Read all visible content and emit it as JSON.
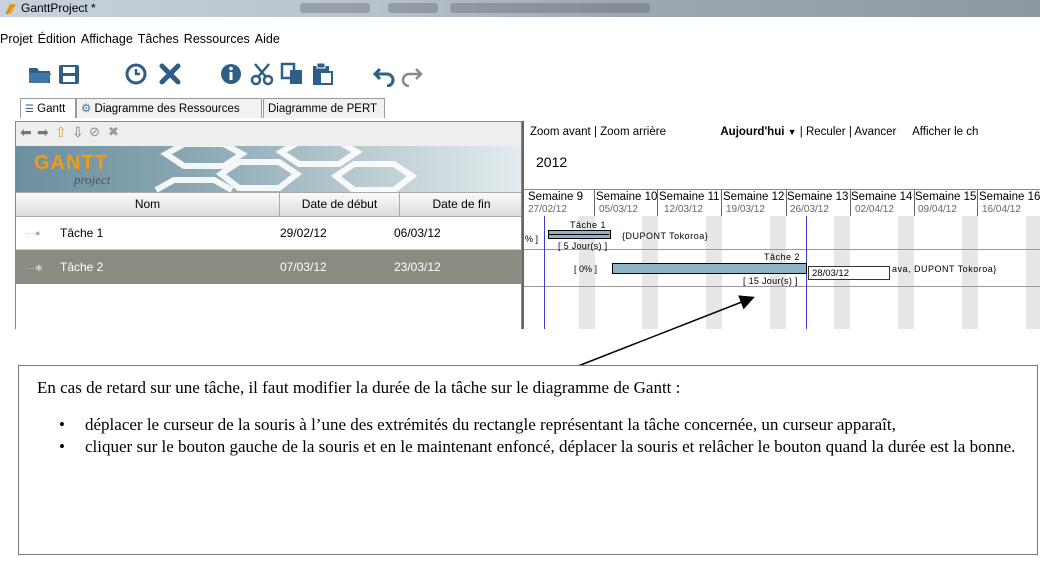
{
  "window": {
    "title": "GanttProject *"
  },
  "menu": [
    "Projet",
    "Édition",
    "Affichage",
    "Tâches",
    "Ressources",
    "Aide"
  ],
  "toolbar": {
    "icons": [
      "open-folder-icon",
      "save-icon",
      "clock-icon",
      "delete-icon",
      "info-icon",
      "cut-icon",
      "copy-icon",
      "paste-icon",
      "undo-icon",
      "redo-icon"
    ]
  },
  "tabs": [
    {
      "label": "Gantt",
      "active": true
    },
    {
      "label": "Diagramme des Ressources",
      "active": false
    },
    {
      "label": "Diagramme de PERT",
      "active": false
    }
  ],
  "logo": {
    "main": "GANTT",
    "sub": "project"
  },
  "table": {
    "headers": [
      "Nom",
      "Date de début",
      "Date de fin"
    ],
    "rows": [
      {
        "name": "Tâche 1",
        "start": "29/02/12",
        "end": "06/03/12",
        "selected": false
      },
      {
        "name": "Tâche 2",
        "start": "07/03/12",
        "end": "23/03/12",
        "selected": true
      }
    ]
  },
  "chart_toolbar": {
    "zoom_in": "Zoom avant",
    "sep1": "|",
    "zoom_out": "Zoom arrière",
    "today": "Aujourd'hui",
    "sep2": "|",
    "back": "Reculer",
    "sep3": "|",
    "forward": "Avancer",
    "show": "Afficher le ch"
  },
  "year": "2012",
  "weeks": [
    {
      "label": "Semaine 9",
      "date": "27/02/12"
    },
    {
      "label": "Semaine 10",
      "date": "05/03/12"
    },
    {
      "label": "Semaine 11",
      "date": "12/03/12"
    },
    {
      "label": "Semaine 12",
      "date": "19/03/12"
    },
    {
      "label": "Semaine 13",
      "date": "26/03/12"
    },
    {
      "label": "Semaine 14",
      "date": "02/04/12"
    },
    {
      "label": "Semaine 15",
      "date": "09/04/12"
    },
    {
      "label": "Semaine 16",
      "date": "16/04/12"
    }
  ],
  "gantt": {
    "task1": {
      "label": "Tâche 1",
      "left_fragment": "% ]",
      "resources": "{DUPONT Tokoroa}",
      "duration": "[ 5 Jour(s) ]"
    },
    "task2": {
      "label": "Tâche 2",
      "progress": "[ 0% ]",
      "resources": "ava, DUPONT Tokoroa}",
      "duration": "[ 15 Jour(s) ]",
      "tooltip_date": "28/03/12"
    }
  },
  "instructions": {
    "intro": "En cas de retard sur une tâche, il faut modifier la durée de la tâche sur le diagramme de Gantt :",
    "bullets": [
      "déplacer le curseur de la souris à l’une des extrémités du rectangle représentant la tâche concernée, un curseur apparaît,",
      "cliquer sur le bouton gauche de la souris et en le maintenant enfoncé, déplacer la souris et relâcher le bouton quand la durée est la bonne."
    ]
  },
  "colors": {
    "bar": "#8fb4c8",
    "selected_row": "#8c8b82",
    "today_line": "#3a3ad8"
  }
}
